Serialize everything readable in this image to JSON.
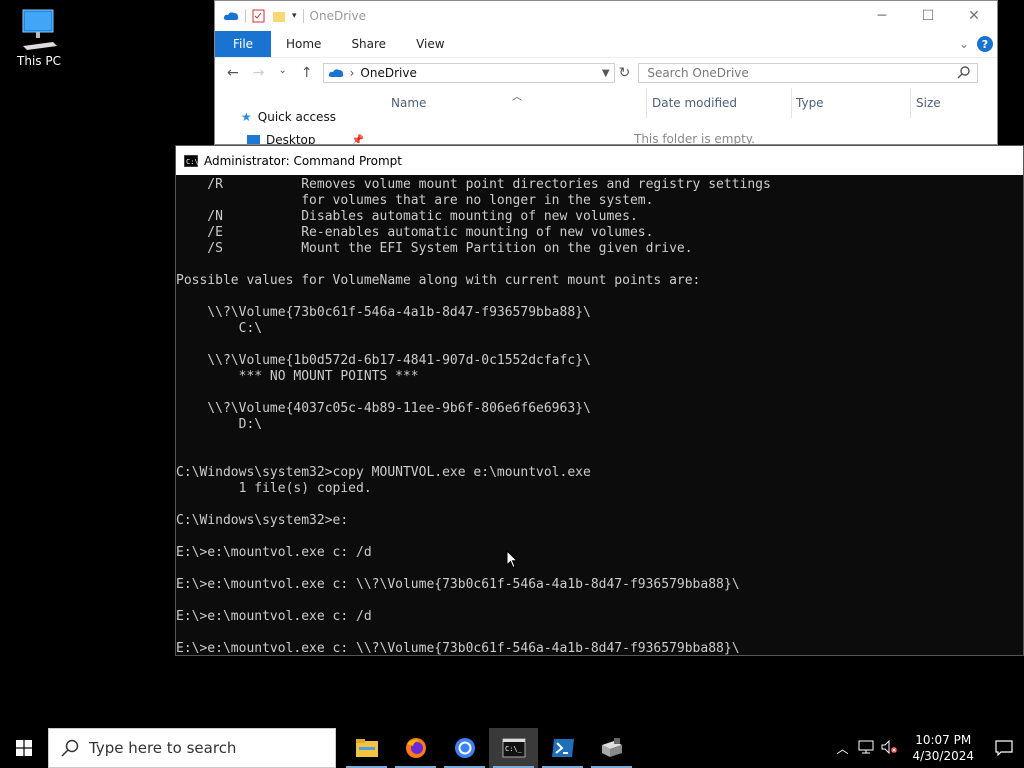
{
  "desktop": {
    "this_pc_label": "This PC"
  },
  "explorer": {
    "title": "OneDrive",
    "ribbon": {
      "file": "File",
      "home": "Home",
      "share": "Share",
      "view": "View"
    },
    "address": {
      "location": "OneDrive"
    },
    "search_placeholder": "Search OneDrive",
    "columns": {
      "name": "Name",
      "date_modified": "Date modified",
      "type": "Type",
      "size": "Size"
    },
    "nav": {
      "quick_access": "Quick access",
      "desktop": "Desktop"
    },
    "empty_message": "This folder is empty."
  },
  "cmd": {
    "title": "Administrator: Command Prompt",
    "lines": [
      "    /R          Removes volume mount point directories and registry settings",
      "                for volumes that are no longer in the system.",
      "    /N          Disables automatic mounting of new volumes.",
      "    /E          Re-enables automatic mounting of new volumes.",
      "    /S          Mount the EFI System Partition on the given drive.",
      "",
      "Possible values for VolumeName along with current mount points are:",
      "",
      "    \\\\?\\Volume{73b0c61f-546a-4a1b-8d47-f936579bba88}\\",
      "        C:\\",
      "",
      "    \\\\?\\Volume{1b0d572d-6b17-4841-907d-0c1552dcfafc}\\",
      "        *** NO MOUNT POINTS ***",
      "",
      "    \\\\?\\Volume{4037c05c-4b89-11ee-9b6f-806e6f6e6963}\\",
      "        D:\\",
      "",
      "",
      "C:\\Windows\\system32>copy MOUNTVOL.exe e:\\mountvol.exe",
      "        1 file(s) copied.",
      "",
      "C:\\Windows\\system32>e:",
      "",
      "E:\\>e:\\mountvol.exe c: /d",
      "",
      "E:\\>e:\\mountvol.exe c: \\\\?\\Volume{73b0c61f-546a-4a1b-8d47-f936579bba88}\\",
      "",
      "E:\\>e:\\mountvol.exe c: /d",
      "",
      "E:\\>e:\\mountvol.exe c: \\\\?\\Volume{73b0c61f-546a-4a1b-8d47-f936579bba88}\\"
    ]
  },
  "taskbar": {
    "search_placeholder": "Type here to search",
    "apps": [
      "file-explorer",
      "firefox",
      "chrome",
      "command-prompt",
      "powershell",
      "server-manager"
    ],
    "time": "10:07 PM",
    "date": "4/30/2024"
  }
}
